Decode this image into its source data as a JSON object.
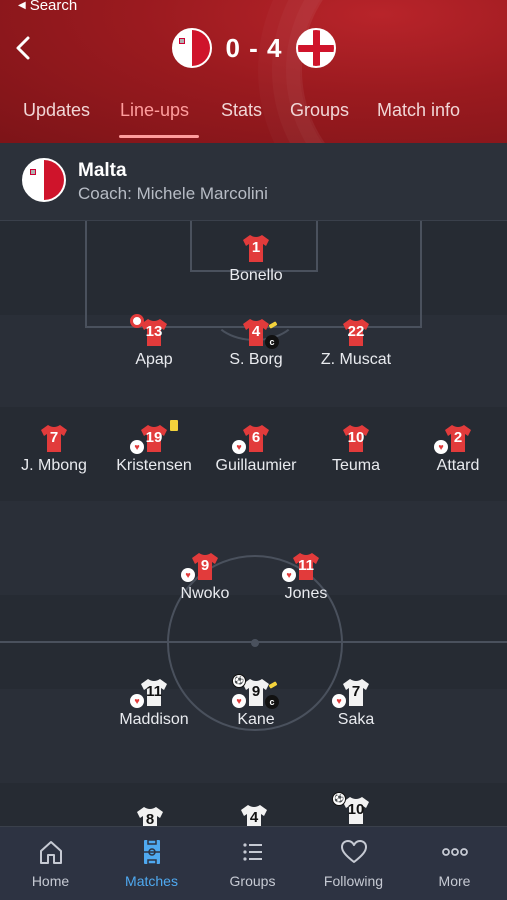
{
  "status_bar": {
    "back_label": "Search"
  },
  "match": {
    "score": "0 - 4",
    "home_flag_icon": "malta-flag-icon",
    "away_flag_icon": "england-flag-icon"
  },
  "tabs": [
    {
      "label": "Updates",
      "active": false
    },
    {
      "label": "Line-ups",
      "active": true
    },
    {
      "label": "Stats",
      "active": false
    },
    {
      "label": "Groups",
      "active": false
    },
    {
      "label": "Match info",
      "active": false
    }
  ],
  "team": {
    "name": "Malta",
    "coach": "Coach: Michele Marcolini"
  },
  "colors": {
    "header_red": "#9a1a1f",
    "malta_shirt": "#e23b3b",
    "england_shirt": "#f2f2f2",
    "active_tab": "#ff9d9d",
    "active_nav": "#4fa9f0",
    "yellow_card": "#f3d33c"
  },
  "players": {
    "malta": [
      {
        "number": "1",
        "name": "Bonello"
      },
      {
        "number": "13",
        "name": "Apap",
        "badge": "target-icon"
      },
      {
        "number": "4",
        "name": "S. Borg",
        "badge": "captain-icon"
      },
      {
        "number": "22",
        "name": "Z. Muscat"
      },
      {
        "number": "7",
        "name": "J. Mbong"
      },
      {
        "number": "19",
        "name": "Kristensen",
        "badge": "yellow-card-icon"
      },
      {
        "number": "6",
        "name": "Guillaumier"
      },
      {
        "number": "10",
        "name": "Teuma"
      },
      {
        "number": "2",
        "name": "Attard"
      },
      {
        "number": "9",
        "name": "Nwoko"
      },
      {
        "number": "11",
        "name": "Jones"
      }
    ],
    "england": [
      {
        "number": "11",
        "name": "Maddison"
      },
      {
        "number": "9",
        "name": "Kane",
        "badge": "captain-icon"
      },
      {
        "number": "7",
        "name": "Saka"
      },
      {
        "number": "8",
        "name": ""
      },
      {
        "number": "4",
        "name": ""
      },
      {
        "number": "10",
        "name": ""
      }
    ]
  },
  "captain_mark": "c",
  "bottom_nav": [
    {
      "label": "Home",
      "icon": "home-icon",
      "active": false
    },
    {
      "label": "Matches",
      "icon": "pitch-icon",
      "active": true
    },
    {
      "label": "Groups",
      "icon": "list-icon",
      "active": false
    },
    {
      "label": "Following",
      "icon": "heart-icon",
      "active": false
    },
    {
      "label": "More",
      "icon": "more-dots-icon",
      "active": false
    }
  ]
}
